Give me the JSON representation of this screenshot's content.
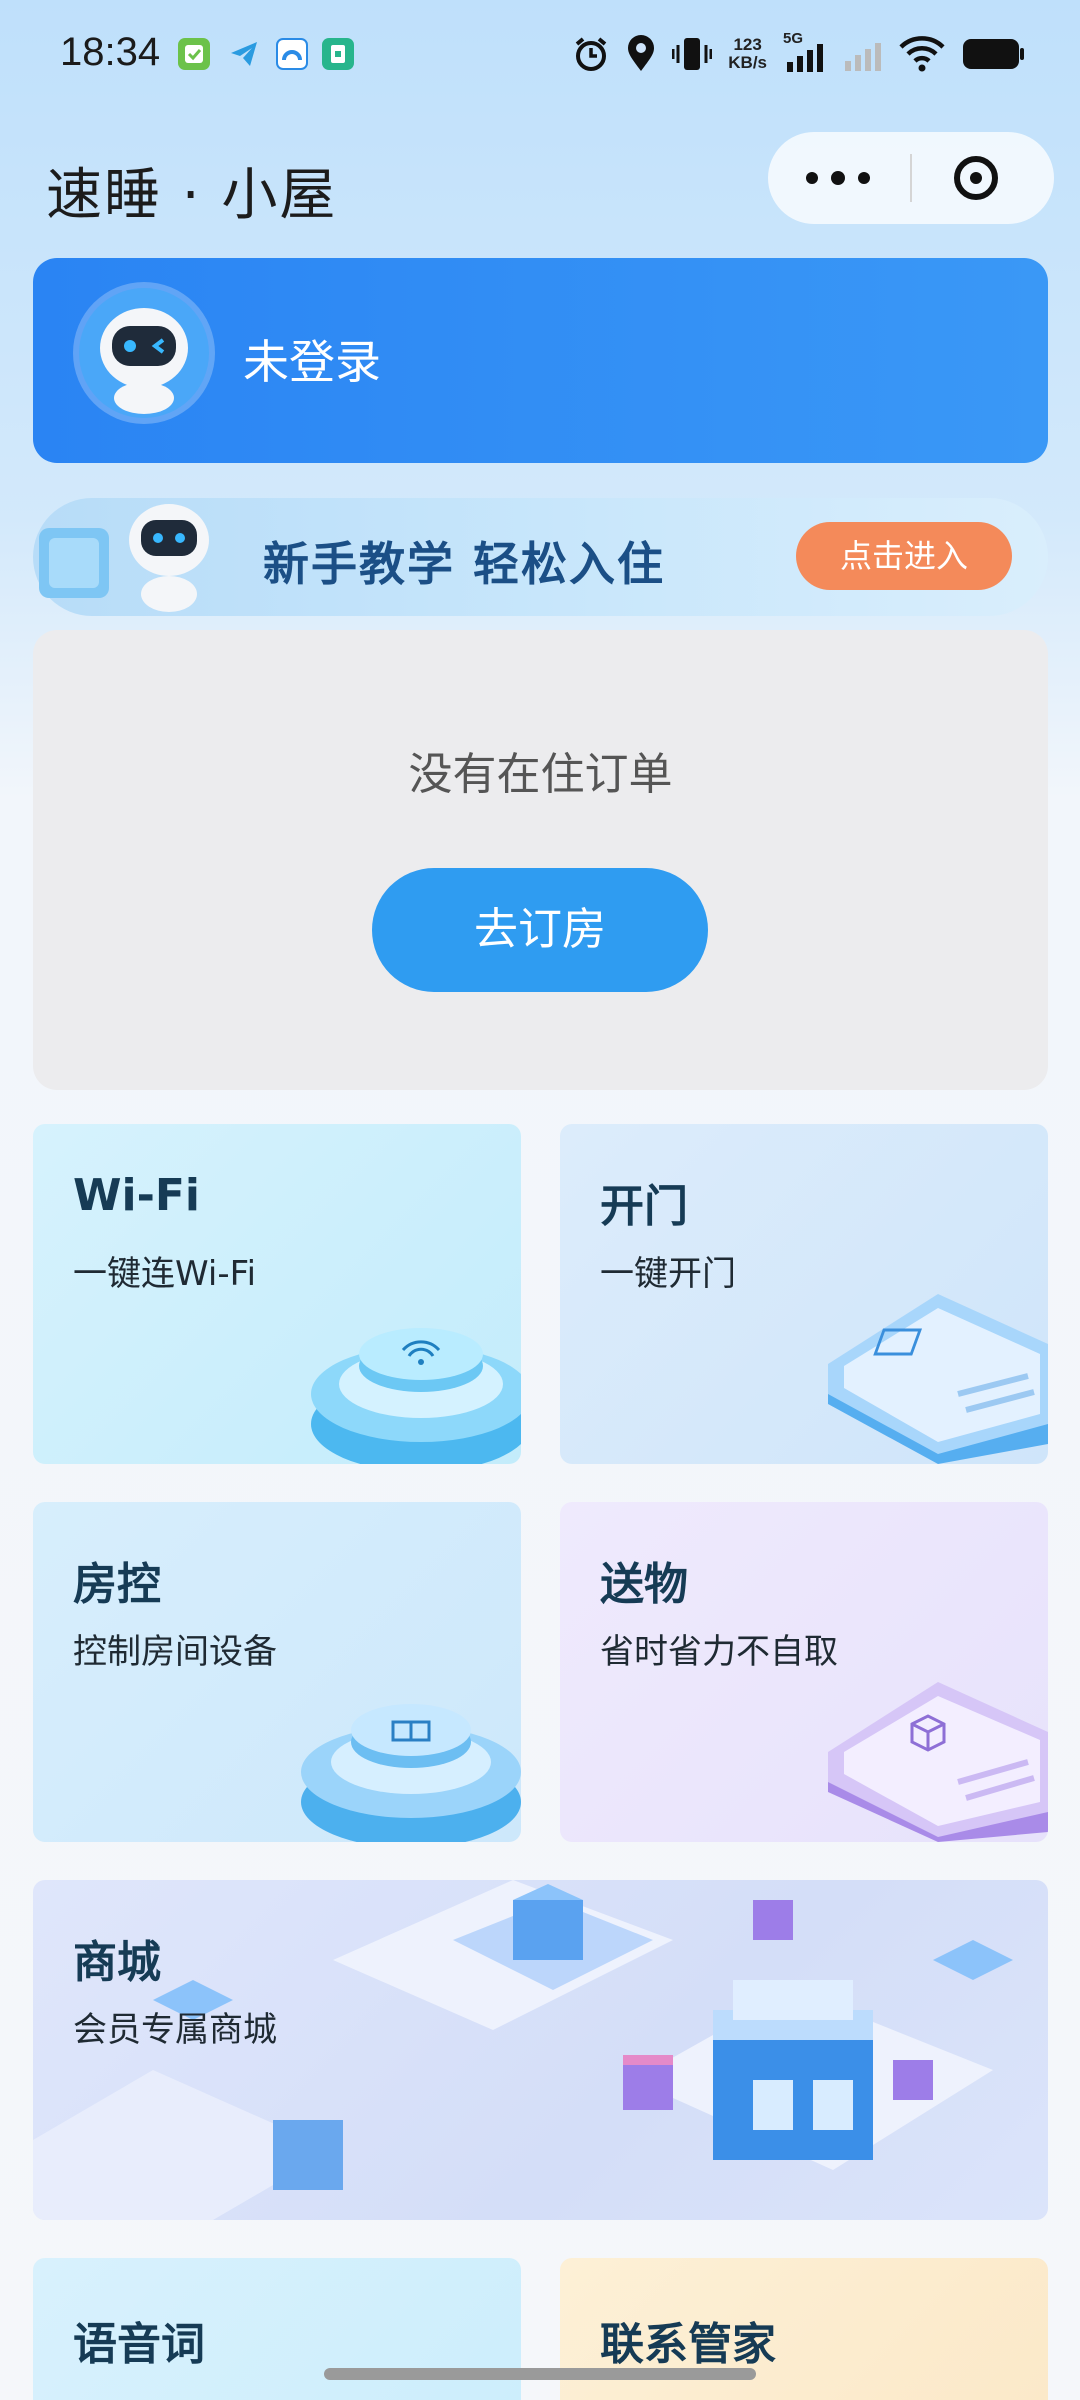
{
  "status_bar": {
    "time": "18:34",
    "net_speed_value": "123",
    "net_speed_unit": "KB/s",
    "network_type": "5G",
    "icons": [
      "wechat-pay-icon",
      "telegram-icon",
      "cloud-app-icon",
      "sim-app-icon",
      "alarm-icon",
      "location-icon",
      "vibrate-icon",
      "signal-icon",
      "signal-weak-icon",
      "wifi-icon",
      "battery-icon"
    ]
  },
  "header": {
    "title": "速睡 · 小屋"
  },
  "login": {
    "label": "未登录"
  },
  "tutorial": {
    "text": "新手教学 轻松入住",
    "button": "点击进入"
  },
  "orders": {
    "empty_text": "没有在住订单",
    "book_button": "去订房"
  },
  "tiles": {
    "wifi": {
      "title": "Wi-Fi",
      "subtitle": "一键连Wi-Fi"
    },
    "door": {
      "title": "开门",
      "subtitle": "一键开门"
    },
    "room": {
      "title": "房控",
      "subtitle": "控制房间设备"
    },
    "gift": {
      "title": "送物",
      "subtitle": "省时省力不自取"
    },
    "mall": {
      "title": "商城",
      "subtitle": "会员专属商城"
    },
    "voice": {
      "title": "语音词"
    },
    "butler": {
      "title": "联系管家"
    }
  },
  "colors": {
    "primary_blue": "#2f9cf1",
    "login_card": "#2a84f3",
    "tutorial_button": "#f48a5a",
    "title_text": "#163b55"
  }
}
